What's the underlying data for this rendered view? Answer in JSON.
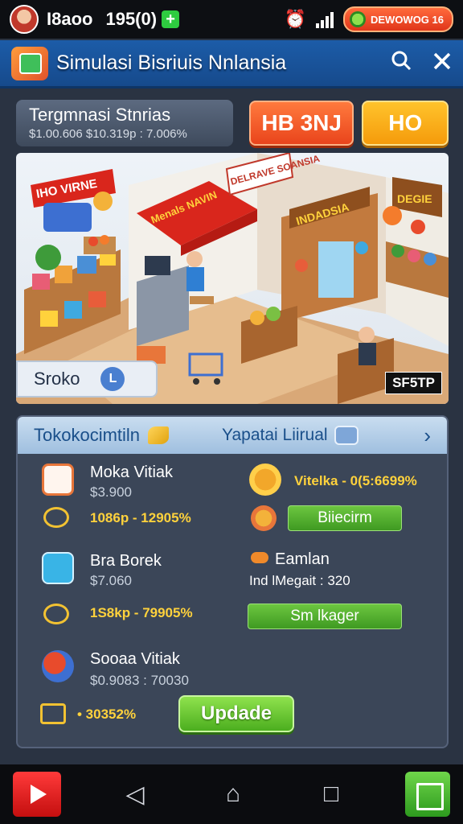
{
  "status_bar": {
    "player_name": "I8aoo",
    "score": "195(0)",
    "add_label": "+",
    "badge_text": "DEWOWOG 16"
  },
  "header": {
    "title": "Simulasi Bisriuis Nnlansia",
    "search_icon": "search-icon",
    "close_icon": "close-icon"
  },
  "summary": {
    "title": "Tergmnasi Stnrias",
    "subtitle": "$1.00.606   $10.319p : 7.006%",
    "button_primary": "HB 3NJ",
    "button_secondary": "HO"
  },
  "scene": {
    "banner_left": "IHO VIRNE",
    "banner_top": "DELRAVE SOANSIA",
    "awning_sign": "Menals NAVIN",
    "store_sign": "INDADSIA",
    "wall_sign": "DEGIE",
    "chip_label": "Sroko",
    "chip_icon": "L",
    "stamp": "SF5TP"
  },
  "panel": {
    "tab_left": "Tokokocimtiln",
    "tab_right": "Yapatai Liirual",
    "items": [
      {
        "name": "Moka Vitiak",
        "price": "$3.900",
        "stat": "1086p - 12905%"
      },
      {
        "name": "Bra Borek",
        "price": "$7.060",
        "stat": "1S8kp - 79905%"
      },
      {
        "name": "Sooaa Vitiak",
        "price": "$0.9083 : 70030",
        "stat": "• 30352%"
      }
    ],
    "right": {
      "stat_top": "Vitelka - 0(5:6699%",
      "button_1": "Biiecirm",
      "eamlan_label": "Eamlan",
      "ind_label": "Ind lMegait : 320",
      "button_2": "Sm lkager"
    },
    "update_button": "Updade"
  },
  "colors": {
    "accent_blue": "#1c5ca8",
    "accent_orange": "#e9441c",
    "accent_yellow": "#f59b0b",
    "accent_green": "#4cae1f",
    "stat_gold": "#ffd23c"
  }
}
